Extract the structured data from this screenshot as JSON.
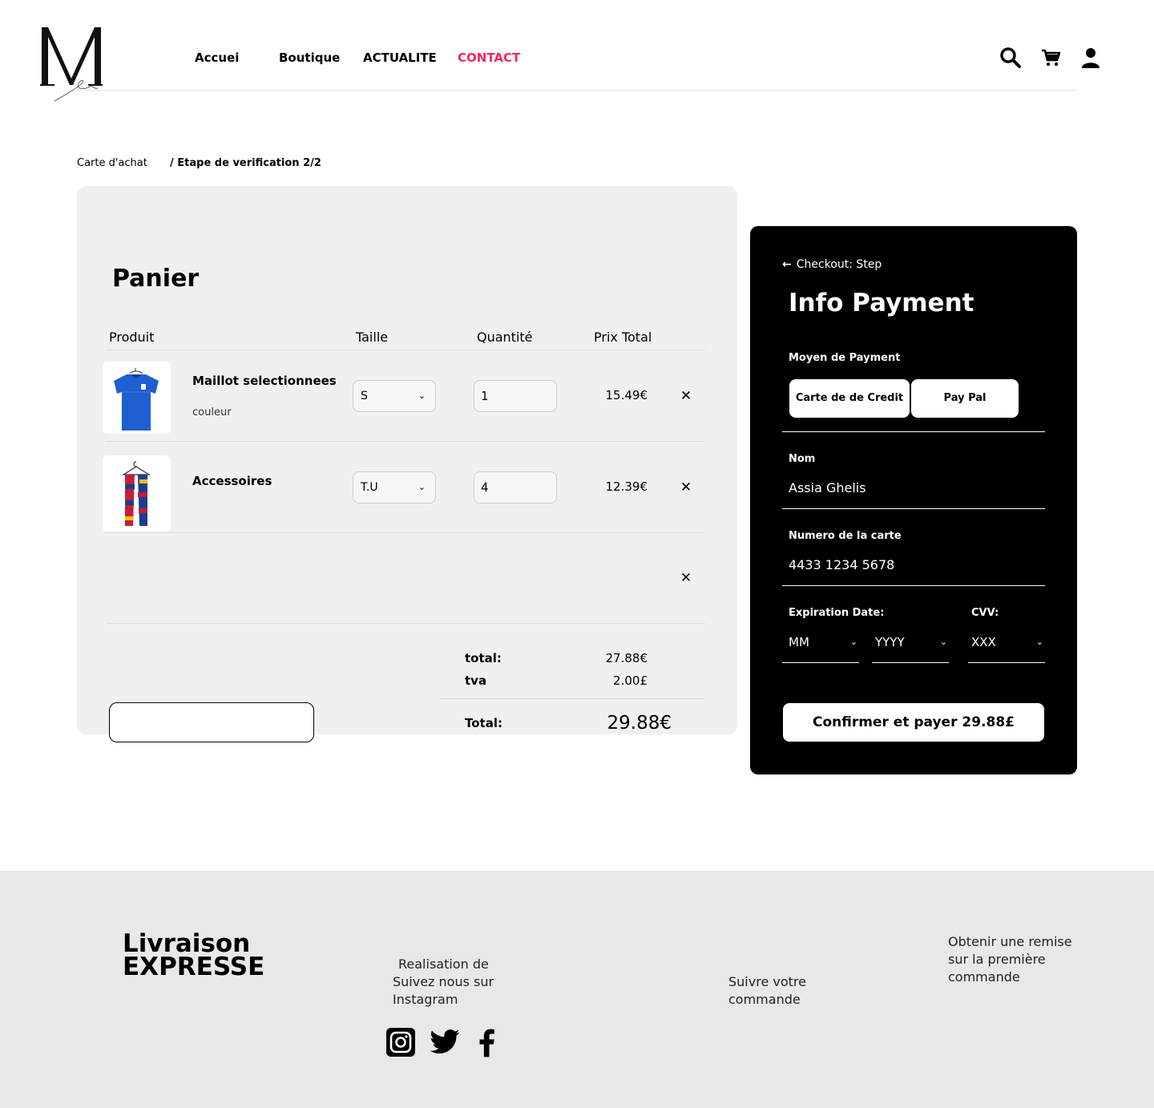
{
  "header": {
    "nav": [
      {
        "label": "Accuei"
      },
      {
        "label": "Boutique"
      },
      {
        "label": "ACTUALITE"
      },
      {
        "label": "CONTACT"
      }
    ],
    "icons": [
      "search-icon",
      "cart-icon",
      "user-icon"
    ],
    "accent_color": "#f0295b"
  },
  "breadcrumb": {
    "first": "Carte d'achat",
    "current": "/ Etape de verification 2/2"
  },
  "cart": {
    "title": "Panier",
    "columns": [
      "Produit",
      "Taille",
      "Quantité",
      "Prix Total"
    ],
    "items": [
      {
        "name": "Maillot selectionnees",
        "sub": "couleur",
        "size": "S",
        "qty": "1",
        "price": "15.49€"
      },
      {
        "name": "Accessoires",
        "size": "T.U",
        "qty": "4",
        "price": "12.39€"
      }
    ],
    "summary": {
      "total_label": "total:",
      "total_value": "27.88€",
      "tva_label": "tva",
      "tva_value": "2.00£",
      "grand_label": "Total:",
      "grand_value": "29.88€"
    }
  },
  "payment": {
    "back_label": "Checkout: Step",
    "title": "Info Payment",
    "method_label": "Moyen de Payment",
    "methods": [
      "Carte de de Credit",
      "Pay Pal"
    ],
    "name_label": "Nom",
    "name_value": "Assia Ghelis",
    "card_label": "Numero de la carte",
    "card_value": "4433 1234 5678",
    "exp_label": "Expiration Date:",
    "cvv_label": "CVV:",
    "month": "MM",
    "year": "YYYY",
    "cvv": "XXX",
    "confirm_label": "Confirmer et payer 29.88£"
  },
  "footer": {
    "title_line1": "Livraison",
    "title_line2": "EXPRESSE",
    "col2_line1": "Realisation de",
    "col2_line2": "Suivez nous sur",
    "col2_line3": "Instagram",
    "col3_line1": "Suivre votre",
    "col3_line2": "commande",
    "col4_line1": "Obtenir une remise",
    "col4_line2": "sur la première",
    "col4_line3": "commande",
    "social": [
      "instagram-icon",
      "twitter-icon",
      "facebook-icon"
    ]
  }
}
